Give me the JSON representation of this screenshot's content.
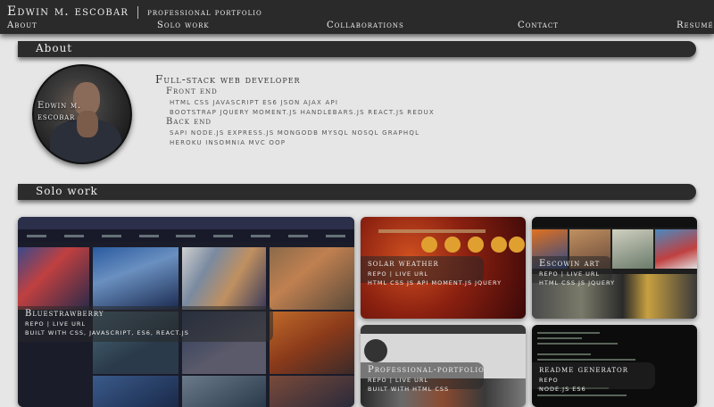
{
  "header": {
    "name": "Edwin m. escobar",
    "subtitle": "professional portfolio",
    "nav": [
      "About",
      "Solo work",
      "Collaborations",
      "Contact",
      "Resumé"
    ]
  },
  "about": {
    "section_title": "About",
    "avatar_name_line1": "Edwin m.",
    "avatar_name_line2": "escobar",
    "title": "Full-stack web developer",
    "front_end_label": "Front end",
    "front_end_line1": "html   css   javascript   es6   json   ajax   api",
    "front_end_line2": "bootstrap   jquery   moment.js   handlebars.js   react.js   redux",
    "back_end_label": "Back end",
    "back_end_line1": "sapi   node.js   express.js   mongodb   mysql   nosql   graphql",
    "back_end_line2": "heroku   insomnia   mvc   oop"
  },
  "solo_work": {
    "section_title": "Solo work",
    "projects": [
      {
        "title": "Bluestrawberry",
        "links": "repo | live url",
        "tech": "built with css, javascript, es6, react.js"
      },
      {
        "title": "solar weather",
        "links": "repo | live url",
        "tech": "html css js api moment.js jquery"
      },
      {
        "title": "Escowin art",
        "links": "repo | live url",
        "tech": "html css js jquery"
      },
      {
        "title": "Professional-portfolio",
        "links": "repo | live url",
        "tech": "built with html css"
      },
      {
        "title": "readme generator",
        "links": "repo",
        "tech": "node.js es6"
      }
    ]
  },
  "colors": {
    "bar_dark": "#2c2c2c",
    "page_bg": "#e6e6e6"
  }
}
